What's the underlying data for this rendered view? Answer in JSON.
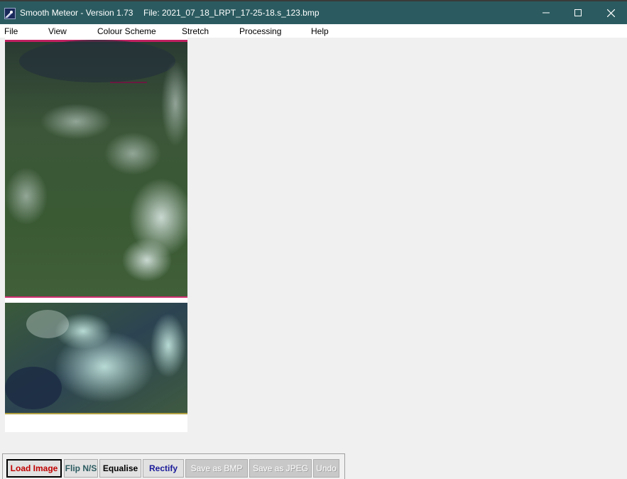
{
  "window": {
    "title": "Smooth Meteor - Version 1.73",
    "file_label": "File: 2021_07_18_LRPT_17-25-18.s_123.bmp",
    "controls": [
      "minimize",
      "maximize",
      "close"
    ]
  },
  "menu": {
    "items": [
      "File",
      "View",
      "Colour Scheme",
      "Stretch",
      "Processing",
      "Help"
    ]
  },
  "toolbar": {
    "buttons": [
      {
        "label": "Load Image",
        "color": "#c00000",
        "enabled": true
      },
      {
        "label": "Flip N/S",
        "color": "#2b5b60",
        "enabled": true
      },
      {
        "label": "Equalise",
        "color": "#000000",
        "enabled": true
      },
      {
        "label": "Rectify",
        "color": "#1a1a9a",
        "enabled": true
      },
      {
        "label": "Save as BMP",
        "color": "#ffffff",
        "enabled": false
      },
      {
        "label": "Save as JPEG",
        "color": "#ffffff",
        "enabled": false
      },
      {
        "label": "Undo",
        "color": "#ffffff",
        "enabled": false
      }
    ]
  },
  "colors": {
    "titlebar": "#2b5b60",
    "background": "#f0f0f0"
  }
}
